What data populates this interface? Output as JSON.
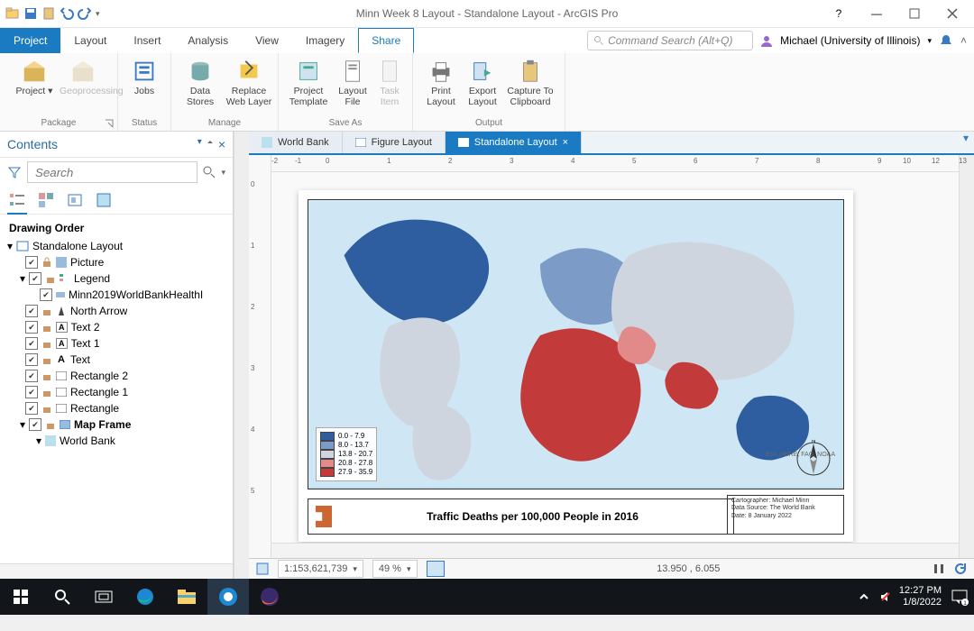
{
  "window": {
    "title": "Minn Week 8 Layout - Standalone Layout - ArcGIS Pro"
  },
  "user": {
    "label": "Michael (University of Illinois)"
  },
  "command_search": {
    "placeholder": "Command Search (Alt+Q)"
  },
  "menutabs": [
    "Project",
    "Layout",
    "Insert",
    "Analysis",
    "View",
    "Imagery",
    "Share"
  ],
  "ribbon": {
    "package": {
      "label": "Package",
      "btns": [
        {
          "l": "Project"
        },
        {
          "l": "Geoprocessing",
          "d": true
        }
      ]
    },
    "status": {
      "label": "Status",
      "btns": [
        {
          "l": "Jobs"
        }
      ]
    },
    "manage": {
      "label": "Manage",
      "btns": [
        {
          "l": "Data Stores"
        },
        {
          "l": "Replace Web Layer"
        }
      ]
    },
    "saveas": {
      "label": "Save As",
      "btns": [
        {
          "l": "Project Template"
        },
        {
          "l": "Layout File"
        },
        {
          "l": "Task Item",
          "d": true
        }
      ]
    },
    "output": {
      "label": "Output",
      "btns": [
        {
          "l": "Print Layout"
        },
        {
          "l": "Export Layout"
        },
        {
          "l": "Capture To Clipboard"
        }
      ]
    }
  },
  "contents": {
    "title": "Contents",
    "search_placeholder": "Search",
    "drawing_order": "Drawing Order",
    "layout": "Standalone Layout",
    "items": [
      "Picture",
      "Legend",
      "Minn2019WorldBankHealthI",
      "North Arrow",
      "Text 2",
      "Text 1",
      "Text",
      "Rectangle 2",
      "Rectangle 1",
      "Rectangle",
      "Map Frame",
      "World Bank"
    ]
  },
  "doctabs": [
    "World Bank",
    "Figure Layout",
    "Standalone Layout"
  ],
  "chart_data": {
    "type": "map",
    "title": "Traffic Deaths per 100,000 People in 2016",
    "legend": [
      {
        "label": "0.0 - 7.9",
        "color": "#2e5e9f"
      },
      {
        "label": "8.0 - 13.7",
        "color": "#7c9cc7"
      },
      {
        "label": "13.8 - 20.7",
        "color": "#cfd5de"
      },
      {
        "label": "20.8 - 27.8",
        "color": "#e28a8a"
      },
      {
        "label": "27.9 - 35.9",
        "color": "#c23a3a"
      }
    ],
    "credit_lines": [
      "Cartographer: Michael Minn",
      "Data Source: The World Bank",
      "Date: 8 January 2022"
    ],
    "attribution": "Esri, HERE, FAO, NOAA"
  },
  "status": {
    "scale": "1:153,621,739",
    "zoom": "49 %",
    "coords": "13.950 , 6.055"
  },
  "taskbar": {
    "time": "12:27 PM",
    "date": "1/8/2022"
  }
}
